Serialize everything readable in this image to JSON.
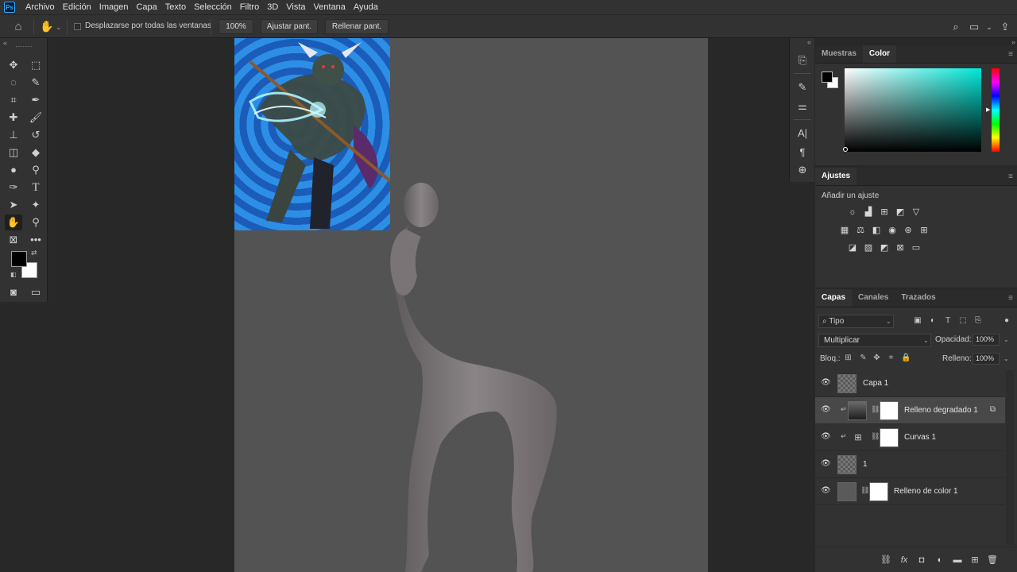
{
  "app": {
    "logo": "Ps"
  },
  "menu": [
    "Archivo",
    "Edición",
    "Imagen",
    "Capa",
    "Texto",
    "Selección",
    "Filtro",
    "3D",
    "Vista",
    "Ventana",
    "Ayuda"
  ],
  "options": {
    "scroll_all_label": "Desplazarse por todas las ventanas",
    "zoom_button": "100%",
    "fit_screen_button": "Ajustar pant.",
    "fill_screen_button": "Rellenar pant."
  },
  "panels": {
    "swatches_tab": "Muestras",
    "color_tab": "Color",
    "adjustments_tab": "Ajustes",
    "adjustments_label": "Añadir un ajuste",
    "layers_tab": "Capas",
    "channels_tab": "Canales",
    "paths_tab": "Trazados"
  },
  "layers": {
    "filter_kind": "Tipo",
    "blend_mode": "Multiplicar",
    "opacity_label": "Opacidad:",
    "opacity_value": "100%",
    "lock_label": "Bloq.:",
    "fill_label": "Relleno:",
    "fill_value": "100%",
    "items": [
      {
        "name": "Capa 1"
      },
      {
        "name": "Relleno degradado 1"
      },
      {
        "name": "Curvas 1"
      },
      {
        "name": "1"
      },
      {
        "name": "Relleno de color 1"
      }
    ]
  },
  "colors": {
    "foreground": "#000000",
    "background": "#ffffff",
    "canvas": "#535353",
    "accent": "#31a8ff"
  }
}
